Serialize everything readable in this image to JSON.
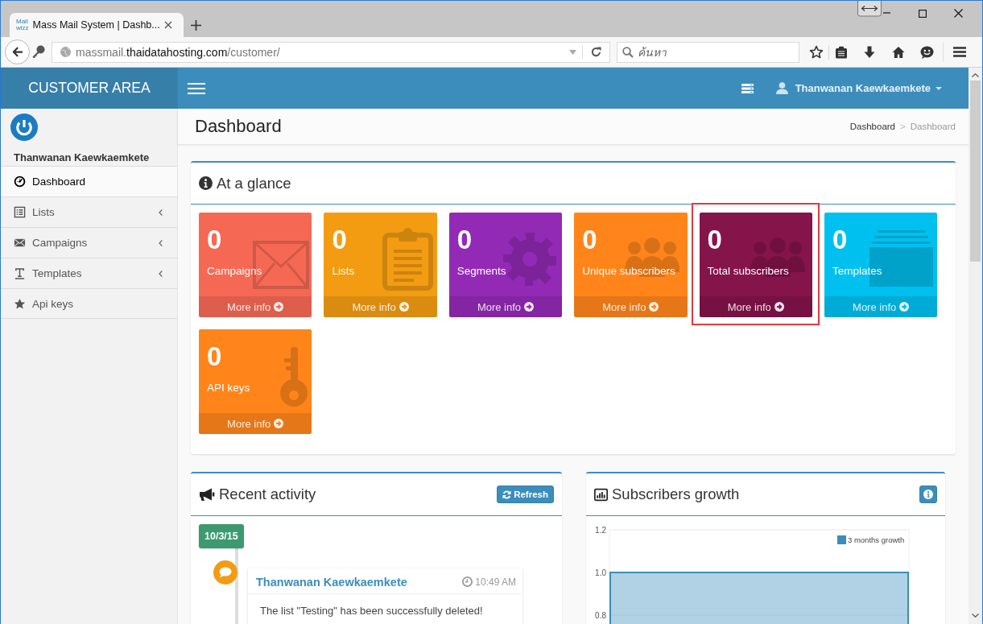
{
  "browser": {
    "tabs": [
      {
        "favicon_text": [
          "Mail",
          "wizz"
        ],
        "title": "Mass Mail System | Dashb...",
        "selected": true
      }
    ],
    "address_bar": {
      "url_subdomain": "massmail.",
      "url_domain": "thaidatahosting.com",
      "url_path": "/customer/"
    },
    "search": {
      "placeholder": "ค้นหา"
    }
  },
  "header": {
    "brand": "CUSTOMER AREA",
    "user_name": "Thanwanan Kaewkaemkete"
  },
  "sidebar": {
    "user_name": "Thanwanan Kaewkaemkete",
    "items": [
      {
        "label": "Dashboard",
        "selected": true,
        "has_submenu": false
      },
      {
        "label": "Lists",
        "selected": false,
        "has_submenu": true
      },
      {
        "label": "Campaigns",
        "selected": false,
        "has_submenu": true
      },
      {
        "label": "Templates",
        "selected": false,
        "has_submenu": true
      },
      {
        "label": "Api keys",
        "selected": false,
        "has_submenu": false
      }
    ]
  },
  "content_header": {
    "title": "Dashboard",
    "breadcrumb": [
      {
        "label": "Dashboard",
        "current": false
      },
      {
        "label": "Dashboard",
        "current": true
      }
    ],
    "separator": ">"
  },
  "at_a_glance": {
    "title": "At a glance",
    "tiles": [
      {
        "value": "0",
        "label": "Campaigns",
        "link": "More info",
        "color": "#f56954",
        "highlighted": false
      },
      {
        "value": "0",
        "label": "Lists",
        "link": "More info",
        "color": "#f39c12",
        "highlighted": false
      },
      {
        "value": "0",
        "label": "Segments",
        "link": "More info",
        "color": "#932ab6",
        "highlighted": false
      },
      {
        "value": "0",
        "label": "Unique subscribers",
        "link": "More info",
        "color": "#ff851b",
        "highlighted": false
      },
      {
        "value": "0",
        "label": "Total subscribers",
        "link": "More info",
        "color": "#85144b",
        "highlighted": true
      },
      {
        "value": "0",
        "label": "Templates",
        "link": "More info",
        "color": "#00c0ef",
        "highlighted": false
      },
      {
        "value": "0",
        "label": "API keys",
        "link": "More info",
        "color": "#ff851b",
        "highlighted": false
      }
    ]
  },
  "recent_activity": {
    "title": "Recent activity",
    "refresh_button": "Refresh",
    "timeline": [
      {
        "date": "10/3/15",
        "entries": [
          {
            "author": "Thanwanan Kaewkaemkete",
            "time": "10:49 AM",
            "message": "The list \"Testing\" has been successfully deleted!"
          }
        ]
      }
    ]
  },
  "subscribers_growth": {
    "title": "Subscribers growth",
    "chart_data": {
      "type": "bar",
      "series": [
        {
          "name": "3 months growth",
          "color": "#3c8dbc",
          "values": [
            1
          ]
        }
      ],
      "ylim": [
        0.6,
        1.2
      ],
      "yticks": [
        {
          "value": 0.8,
          "label": "0.8"
        },
        {
          "value": 1,
          "label": "1.0"
        },
        {
          "value": 1.2,
          "label": "1.2"
        }
      ]
    }
  }
}
